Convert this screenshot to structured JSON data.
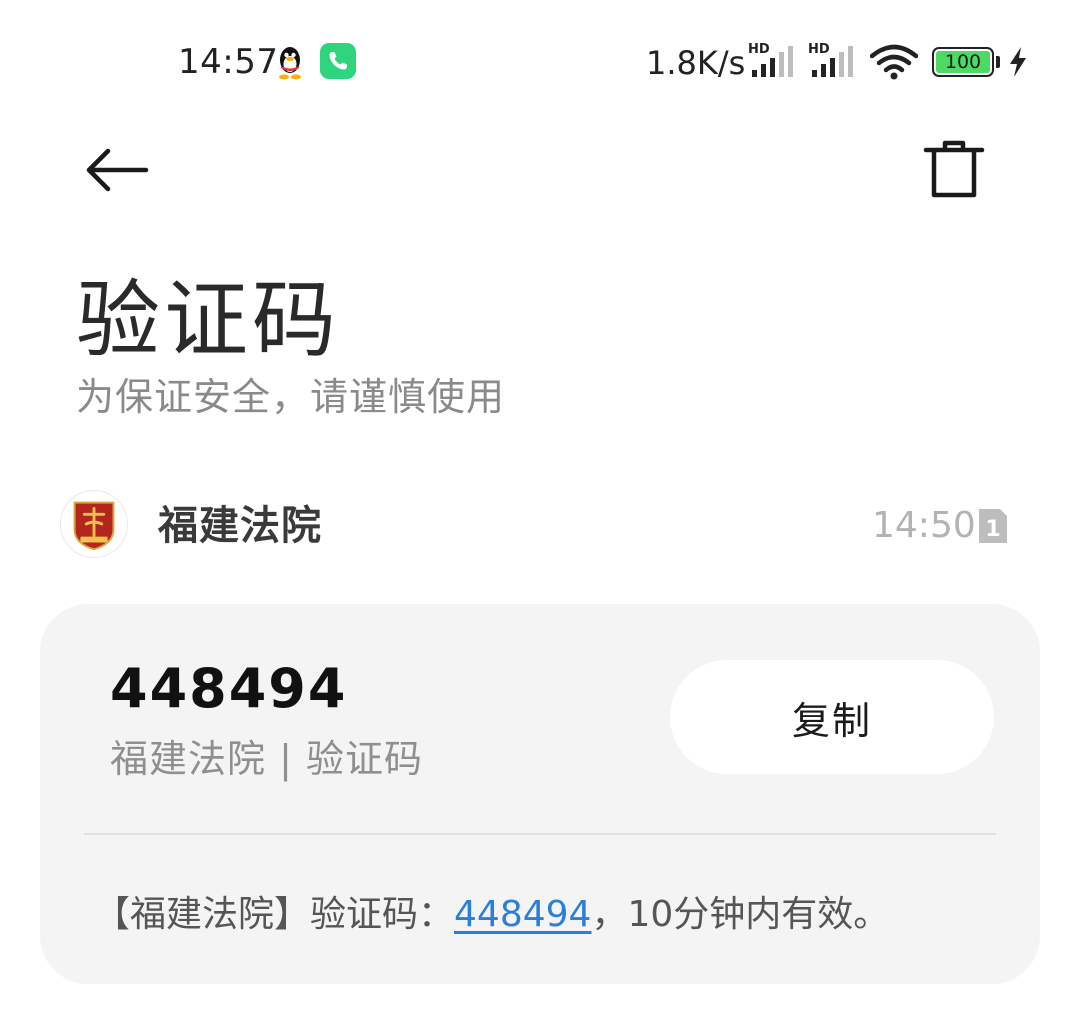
{
  "status_bar": {
    "time": "14:57",
    "network_speed": "1.8K/s",
    "signal_label_1": "HD",
    "signal_label_2": "HD",
    "battery_level": "100",
    "notification_icons": [
      "qq-penguin-icon",
      "phone-call-icon"
    ],
    "accent_phone": "#2fd57c",
    "battery_color": "#4cd964"
  },
  "toolbar": {
    "back_icon": "arrow-left-icon",
    "delete_icon": "trash-icon"
  },
  "header": {
    "title": "验证码",
    "subtitle": "为保证安全，请谨慎使用"
  },
  "sender": {
    "name": "福建法院",
    "time": "14:50",
    "sim_slot": "1",
    "avatar_icon": "court-emblem-icon",
    "avatar_color": "#b3261e"
  },
  "card": {
    "code": "448494",
    "source": "福建法院 | 验证码",
    "copy_label": "复制",
    "body_prefix": "【福建法院】验证码：",
    "body_code": "448494",
    "body_suffix": "，10分钟内有效。",
    "link_color": "#2b7fd8"
  }
}
